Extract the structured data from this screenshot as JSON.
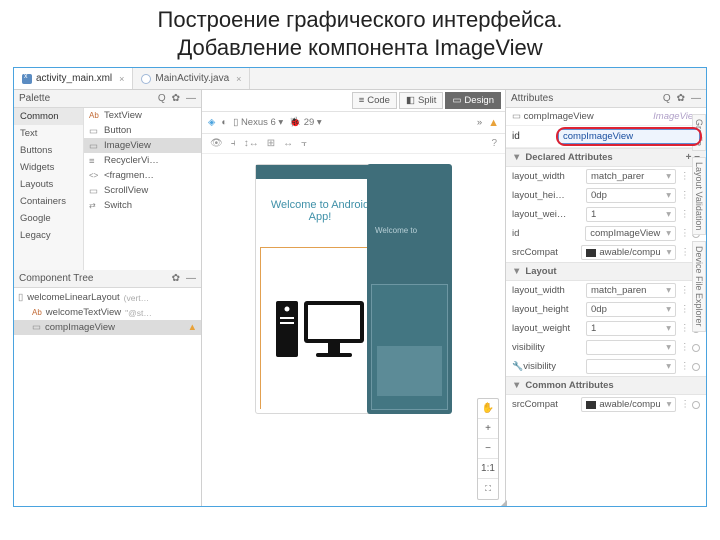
{
  "slide": {
    "title_line1": "Построение графического интерфейса.",
    "title_line2": "Добавление компонента ImageView"
  },
  "tabs": [
    {
      "label": "activity_main.xml",
      "active": true,
      "iconClass": "xml-icon"
    },
    {
      "label": "MainActivity.java",
      "active": false,
      "iconClass": "java-icon"
    }
  ],
  "side_labels": [
    "Gradle",
    "Layout Validation",
    "Device File Explorer"
  ],
  "mode_bar": {
    "code": "Code",
    "split": "Split",
    "design": "Design"
  },
  "palette": {
    "title": "Palette",
    "categories": [
      "Common",
      "Text",
      "Buttons",
      "Widgets",
      "Layouts",
      "Containers",
      "Google",
      "Legacy"
    ],
    "selected_category": "Common",
    "items": [
      {
        "label": "TextView",
        "icon": "Ab"
      },
      {
        "label": "Button",
        "icon": "▭"
      },
      {
        "label": "ImageView",
        "icon": "▭",
        "selected": true
      },
      {
        "label": "RecyclerVi…",
        "icon": "≡"
      },
      {
        "label": "<fragmen…",
        "icon": "<>"
      },
      {
        "label": "ScrollView",
        "icon": "▭"
      },
      {
        "label": "Switch",
        "icon": "⇄"
      }
    ]
  },
  "component_tree": {
    "title": "Component Tree",
    "items": [
      {
        "label": "welcomeLinearLayout",
        "hint": "(vert…",
        "icon": "▯",
        "indent": 0
      },
      {
        "label": "welcomeTextView",
        "hint": "\"@st…",
        "icon": "Ab",
        "indent": 1
      },
      {
        "label": "compImageView",
        "hint": "",
        "icon": "▭",
        "indent": 1,
        "selected": true,
        "warn": true
      }
    ]
  },
  "device_bar": {
    "device": "Nexus 6",
    "api": "29"
  },
  "preview": {
    "welcome": "Welcome to Android App!",
    "blueprint_welcome": "Welcome to"
  },
  "zoom": {
    "pan": "✋",
    "in": "+",
    "out": "−",
    "ratio": "1:1",
    "fit": "⛶"
  },
  "attributes": {
    "title": "Attributes",
    "component_name": "compImageView",
    "component_type": "ImageView",
    "id_label": "id",
    "id_value": "compImageView",
    "declared": {
      "title": "Declared Attributes",
      "rows": [
        {
          "key": "layout_width",
          "val": "match_parer"
        },
        {
          "key": "layout_hei…",
          "val": "0dp"
        },
        {
          "key": "layout_wei…",
          "val": "1"
        },
        {
          "key": "id",
          "val": "compImageView"
        },
        {
          "key": "srcCompat",
          "val": "awable/compu",
          "pic": true
        }
      ]
    },
    "layout_section": {
      "title": "Layout",
      "rows": [
        {
          "key": "layout_width",
          "val": "match_paren"
        },
        {
          "key": "layout_height",
          "val": "0dp"
        },
        {
          "key": "layout_weight",
          "val": "1"
        },
        {
          "key": "visibility",
          "val": ""
        },
        {
          "key": "visibility",
          "val": "",
          "wrench": true
        }
      ]
    },
    "common": {
      "title": "Common Attributes",
      "rows": [
        {
          "key": "srcCompat",
          "val": "awable/compu",
          "pic": true
        }
      ]
    }
  }
}
